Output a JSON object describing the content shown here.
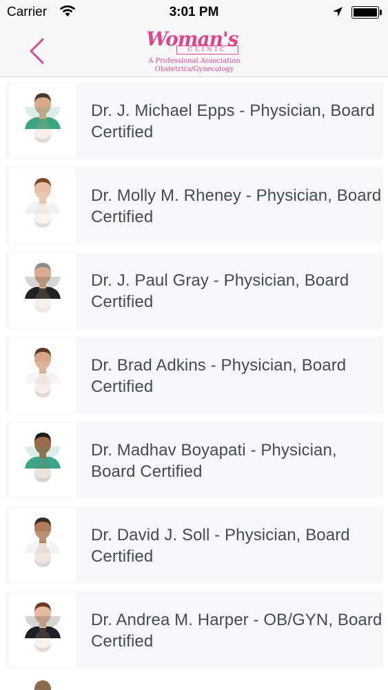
{
  "status_bar": {
    "carrier": "Carrier",
    "time": "3:01 PM"
  },
  "nav": {
    "back_icon": "chevron-left-icon",
    "logo": {
      "script": "Woman's",
      "clinic": "CLINIC",
      "line1": "A Professional Association",
      "line2": "Obstetrics/Gynecology"
    }
  },
  "colors": {
    "accent": "#e0458f",
    "text": "#454a52",
    "card": "#f8f8fa"
  },
  "physicians": [
    {
      "title": "Dr. J. Michael Epps - Physician, Board Certified",
      "skin": "#d9a98a",
      "hair": "#4a3a2e",
      "shirt": "#3aa57f"
    },
    {
      "title": "Dr. Molly M. Rheney - Physician, Board Certified",
      "skin": "#e7bfa5",
      "hair": "#7a4a2a",
      "shirt": "#f2f2f2"
    },
    {
      "title": "Dr. J. Paul Gray - Physician, Board Certified",
      "skin": "#d8ad92",
      "hair": "#8c8c8c",
      "shirt": "#222222"
    },
    {
      "title": "Dr. Brad Adkins - Physician, Board Certified",
      "skin": "#d9a588",
      "hair": "#5a3a22",
      "shirt": "#f4f4f4"
    },
    {
      "title": "Dr. Madhav Boyapati - Physician, Board Certified",
      "skin": "#9c6a48",
      "hair": "#1e1a18",
      "shirt": "#3aa58a"
    },
    {
      "title": "Dr. David J. Soll - Physician, Board Certified",
      "skin": "#b07b56",
      "hair": "#3a2a22",
      "shirt": "#f4f4f4"
    },
    {
      "title": "Dr. Andrea M. Harper - OB/GYN, Board Certified",
      "skin": "#e6bb9f",
      "hair": "#6a3a22",
      "shirt": "#1e1e24"
    }
  ]
}
